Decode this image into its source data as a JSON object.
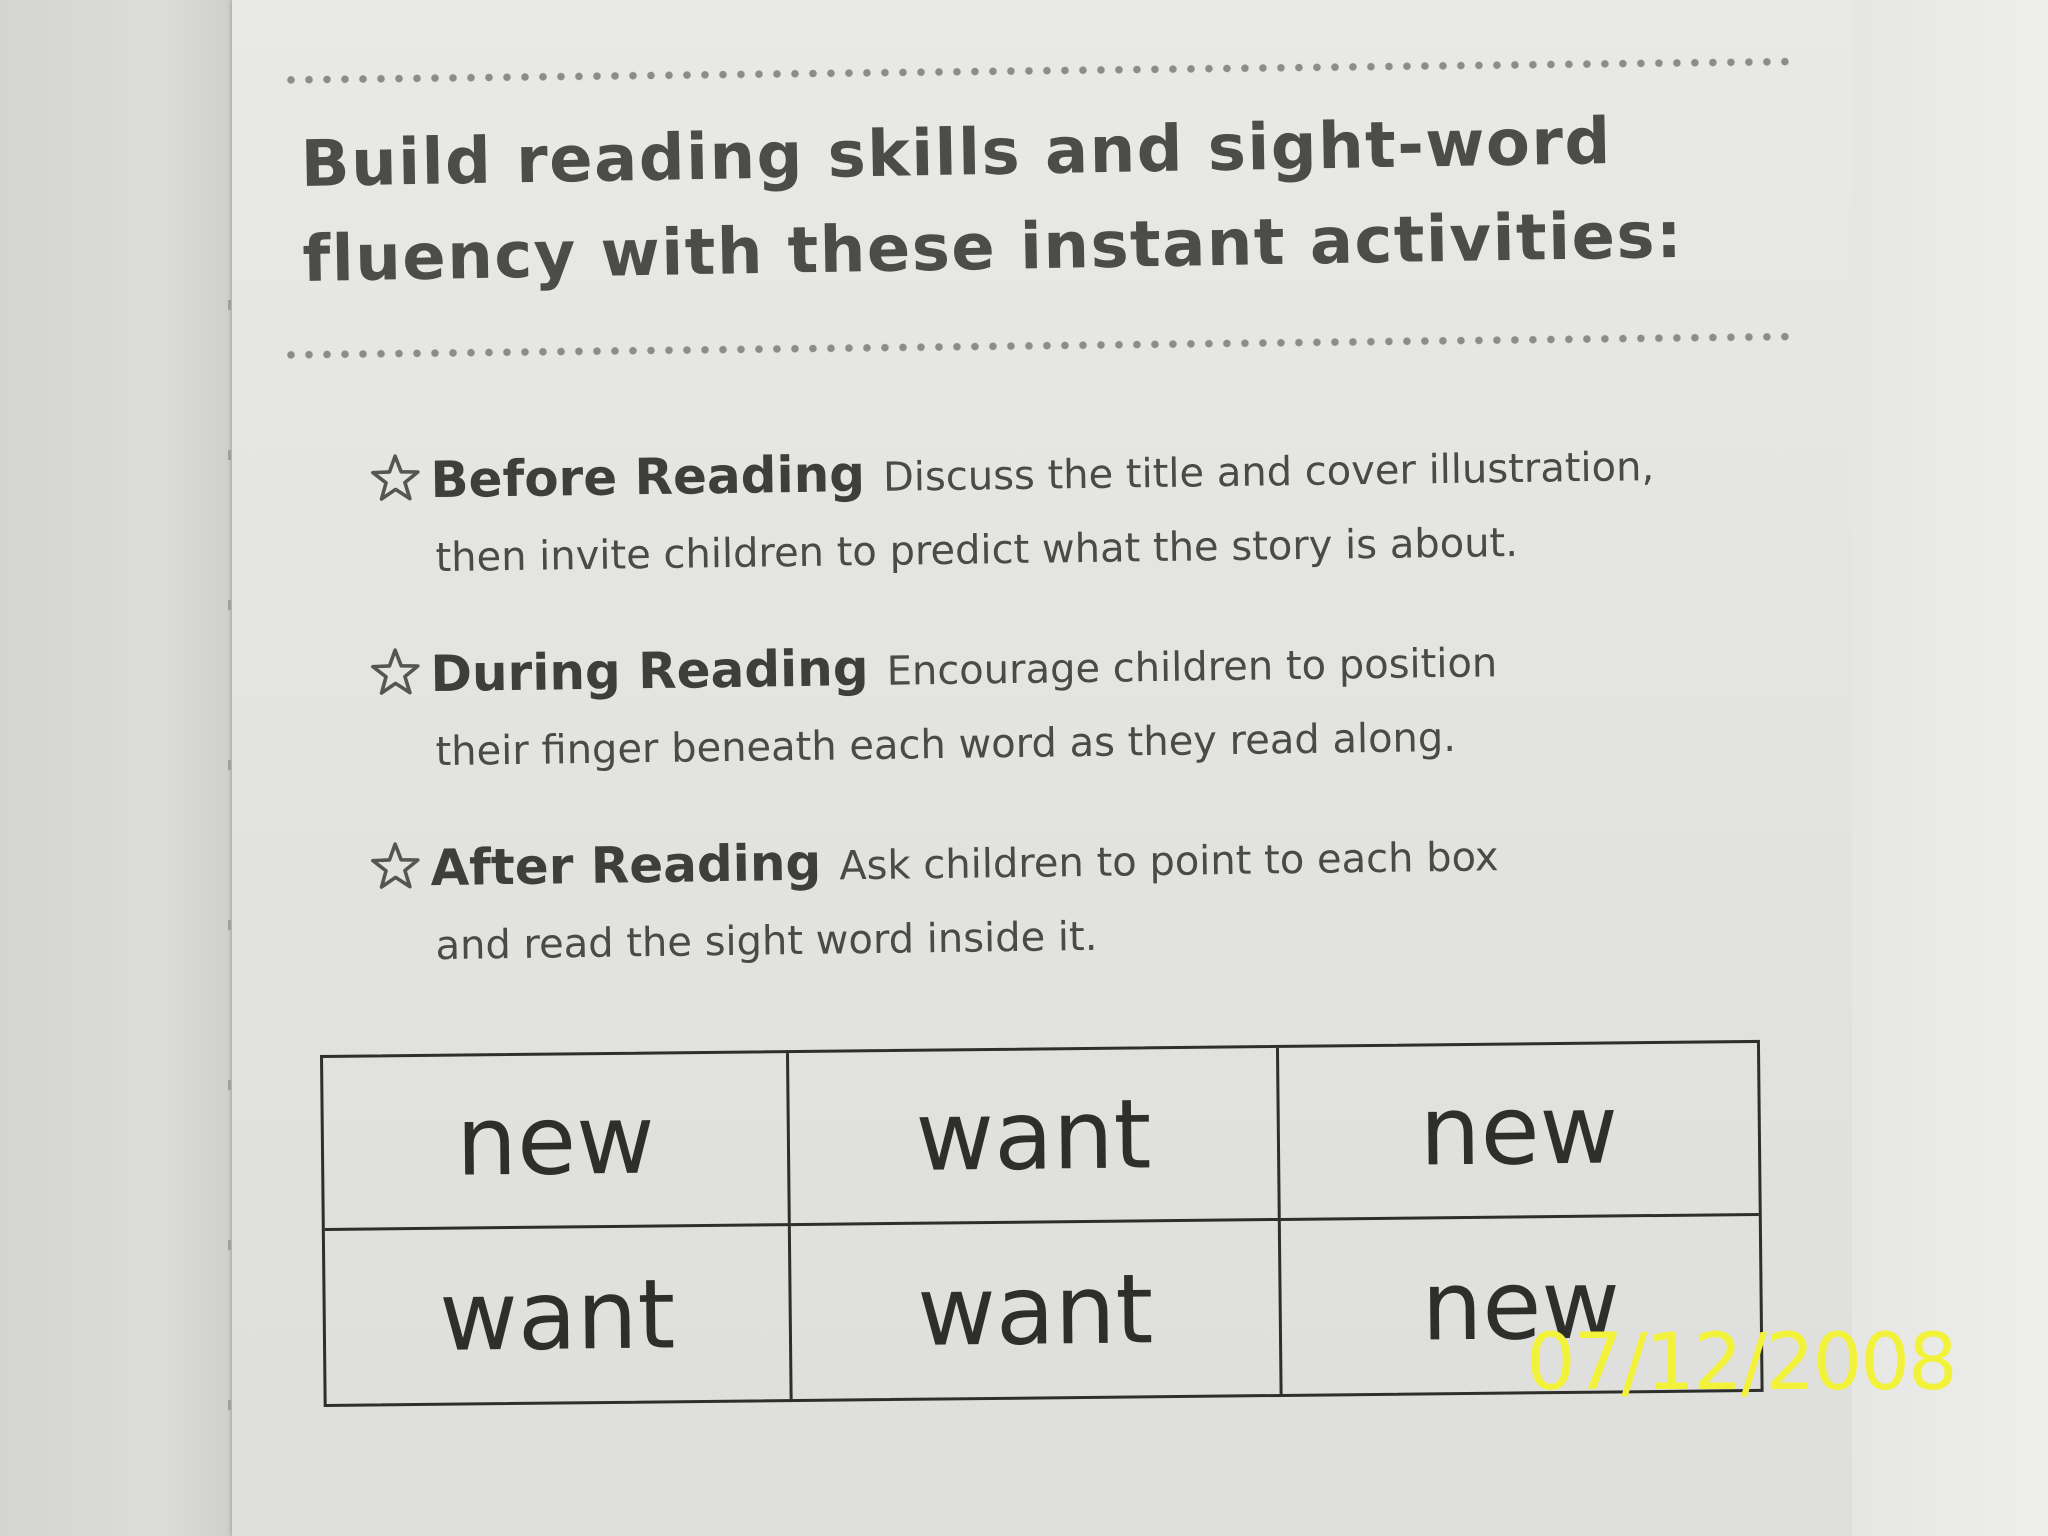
{
  "heading": {
    "line1": "Build reading skills and sight-word",
    "line2": "fluency with these instant activities:"
  },
  "activities": [
    {
      "icon": "star-outline-icon",
      "title": "Before Reading",
      "text_line1": "Discuss the title and cover illustration,",
      "text_line2": "then invite children to predict what the story is about."
    },
    {
      "icon": "star-outline-icon",
      "title": "During Reading",
      "text_line1": "Encourage children to position",
      "text_line2": "their finger beneath each word as they read along."
    },
    {
      "icon": "star-outline-icon",
      "title": "After Reading",
      "text_line1": "Ask children to point to each box",
      "text_line2": "and read the sight word inside it."
    }
  ],
  "sight_words": [
    [
      "new",
      "want",
      "new"
    ],
    [
      "want",
      "want",
      "new"
    ]
  ],
  "date_stamp": "07/12/2008",
  "colors": {
    "text": "#4a4a48",
    "stamp": "#f2f23a",
    "page": "#e6e6e4"
  }
}
